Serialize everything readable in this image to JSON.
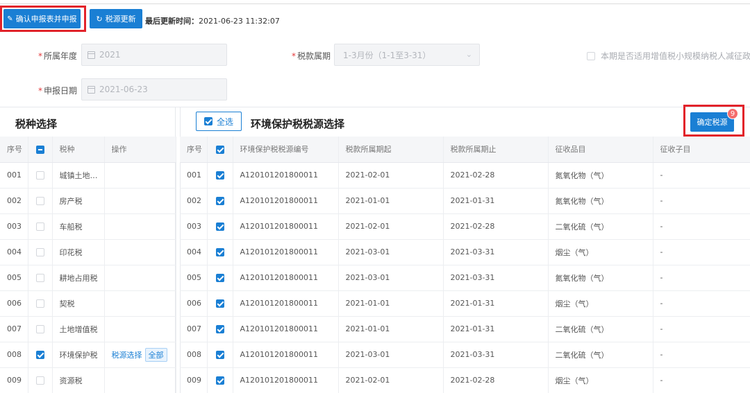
{
  "toolbar": {
    "confirm_label": "确认申报表并申报",
    "refresh_label": "税源更新",
    "last_update_label": "最后更新时间：",
    "last_update_value": "2021-06-23 11:32:07"
  },
  "form": {
    "year_label": "所属年度",
    "year_value": "2021",
    "period_label": "税款属期",
    "period_value": "1-3月份（1-1至3-31）",
    "date_label": "申报日期",
    "date_value": "2021-06-23",
    "policy_label": "本期是否适用增值税小规模纳税人减征政策",
    "required_mark": "*"
  },
  "left": {
    "title": "税种选择",
    "headers": [
      "序号",
      "",
      "税种",
      "操作"
    ],
    "rows": [
      {
        "no": "001",
        "name": "城镇土地使…",
        "checked": false
      },
      {
        "no": "002",
        "name": "房产税",
        "checked": false
      },
      {
        "no": "003",
        "name": "车船税",
        "checked": false
      },
      {
        "no": "004",
        "name": "印花税",
        "checked": false
      },
      {
        "no": "005",
        "name": "耕地占用税",
        "checked": false
      },
      {
        "no": "006",
        "name": "契税",
        "checked": false
      },
      {
        "no": "007",
        "name": "土地增值税",
        "checked": false
      },
      {
        "no": "008",
        "name": "环境保护税",
        "checked": true,
        "op_link": "税源选择",
        "op_tag": "全部"
      },
      {
        "no": "009",
        "name": "资源税",
        "checked": false
      }
    ]
  },
  "right": {
    "select_all_label": "全选",
    "title": "环境保护税税源选择",
    "confirm_label": "确定税源",
    "badge_count": "9",
    "headers": [
      "序号",
      "",
      "环境保护税税源编号",
      "税款所属期起",
      "税款所属期止",
      "征收品目",
      "征收子目"
    ],
    "rows": [
      {
        "no": "001",
        "code": "A120101201800011",
        "start": "2021-02-01",
        "end": "2021-02-28",
        "item": "氮氧化物（气）",
        "sub": "-"
      },
      {
        "no": "002",
        "code": "A120101201800011",
        "start": "2021-01-01",
        "end": "2021-01-31",
        "item": "氮氧化物（气）",
        "sub": "-"
      },
      {
        "no": "003",
        "code": "A120101201800011",
        "start": "2021-02-01",
        "end": "2021-02-28",
        "item": "二氧化硫（气）",
        "sub": "-"
      },
      {
        "no": "004",
        "code": "A120101201800011",
        "start": "2021-03-01",
        "end": "2021-03-31",
        "item": "烟尘（气）",
        "sub": "-"
      },
      {
        "no": "005",
        "code": "A120101201800011",
        "start": "2021-03-01",
        "end": "2021-03-31",
        "item": "氮氧化物（气）",
        "sub": "-"
      },
      {
        "no": "006",
        "code": "A120101201800011",
        "start": "2021-01-01",
        "end": "2021-01-31",
        "item": "烟尘（气）",
        "sub": "-"
      },
      {
        "no": "007",
        "code": "A120101201800011",
        "start": "2021-01-01",
        "end": "2021-01-31",
        "item": "二氧化硫（气）",
        "sub": "-"
      },
      {
        "no": "008",
        "code": "A120101201800011",
        "start": "2021-03-01",
        "end": "2021-03-31",
        "item": "二氧化硫（气）",
        "sub": "-"
      },
      {
        "no": "009",
        "code": "A120101201800011",
        "start": "2021-02-01",
        "end": "2021-02-28",
        "item": "烟尘（气）",
        "sub": "-"
      }
    ]
  },
  "colors": {
    "primary": "#1a7fd4",
    "highlight": "#e2232a",
    "badge": "#f56c6c"
  }
}
